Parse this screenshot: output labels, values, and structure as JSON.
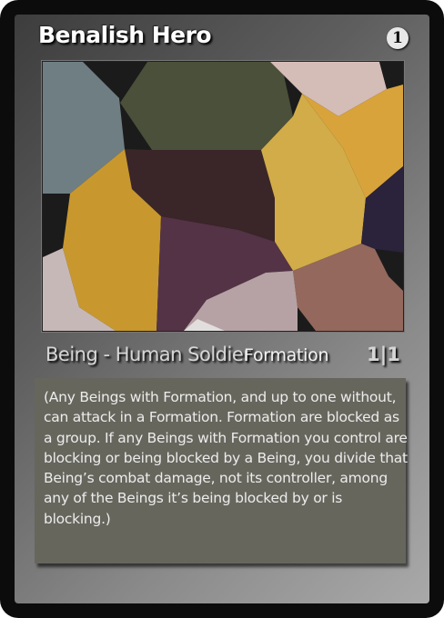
{
  "card": {
    "name": "Benalish Hero",
    "mana_cost": "1",
    "type_line": "Being - Human Soldier",
    "keyword": "Formation",
    "power_toughness": "1|1",
    "rules_text": "(Any Beings with Formation, and up to one without, can attack in a Formation. Formation are blocked as a group. If any Beings with Formation you control are blocking or being blocked by a Being, you divide that Being’s combat damage, not its controller, among any of the Beings it’s being blocked by or is blocking.)"
  },
  "art": {
    "icon": "abstract-voronoi-art",
    "colors": [
      "#1b1b1b",
      "#6f7e83",
      "#4a5039",
      "#d4bcb7",
      "#d9a33b",
      "#3a2528",
      "#c8982f",
      "#d1ac49",
      "#2b223b",
      "#533345",
      "#c7b8b8",
      "#94685d",
      "#b6a2a4"
    ]
  },
  "theme": {
    "border": "#0c0c0c",
    "frame": "#8a8a8a",
    "textbox": "#67665d",
    "text": "#ececec"
  }
}
